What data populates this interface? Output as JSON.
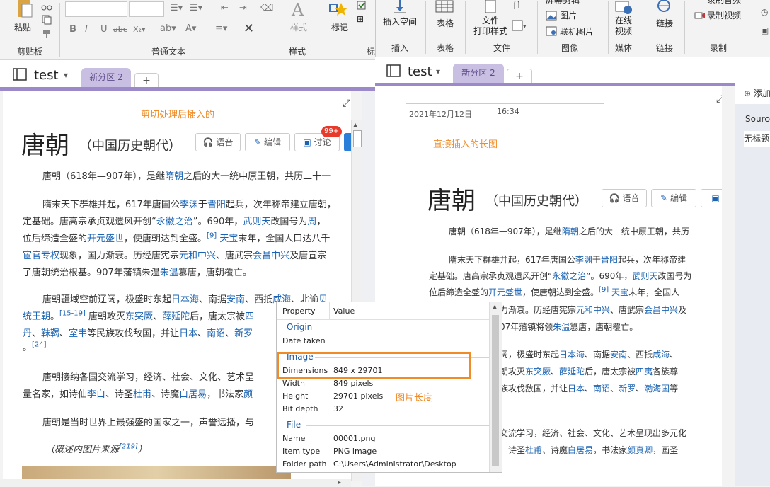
{
  "left_ribbon": {
    "paste": "粘贴",
    "clipboard": "剪贴板",
    "basic_text": "普通文本",
    "styles": "样式",
    "styles_btn": "样式",
    "tags": "标记",
    "tags_short": "标"
  },
  "right_ribbon": {
    "insert_space": "插入空间",
    "insert_group": "插入",
    "table": "表格",
    "table_group": "表格",
    "file_print": "文件\n打印样式",
    "file_group": "文件",
    "picture": "图片",
    "online_picture": "联机图片",
    "image_group": "图像",
    "online_video": "在线\n视频",
    "media_group": "媒体",
    "link": "链接",
    "link_group": "链接",
    "record_video": "录制视频",
    "record_group": "录制",
    "screen_clip": "屏幕剪辑",
    "record_audio": "录制音频"
  },
  "left_window": {
    "notebook": "test",
    "section_tab": "新分区 2",
    "plus": "+",
    "caption": "剪切处理后插入的",
    "title": "唐朝",
    "subtitle": "（中国历史朝代）",
    "btn_voice": "语音",
    "btn_edit": "编辑",
    "btn_discuss": "讨论",
    "badge": "99+",
    "lines": [
      [
        "唐朝（618年—907年），是继",
        "隋朝",
        "之后的大一统中原王朝，共历二十一"
      ],
      [
        "隋末天下群雄并起，617年唐国公",
        "李渊",
        "于",
        "晋阳",
        "起兵，次年称帝建立唐朝，"
      ],
      [
        "定基础。唐高宗承贞观遗风开创“",
        "永徽之治",
        "”。690年，",
        "武则天",
        "改国号为",
        "周",
        "，"
      ],
      [
        "位后缔造全盛的",
        "开元盛世",
        "，使唐朝达到全盛。",
        "[9]",
        " ",
        "天宝",
        "末年，全国人口达八千"
      ],
      [
        "宦官专权",
        "现象，国力渐衰。历经唐宪宗",
        "元和中兴",
        "、唐武宗",
        "会昌中兴",
        "及唐宣宗"
      ],
      [
        "了唐朝统治根基。907年藩镇朱温",
        "朱温",
        "篡唐，唐朝覆亡。"
      ],
      [
        "唐朝疆域空前辽阔，极盛时东起",
        "日本海",
        "、南据",
        "安南",
        "、西抵",
        "咸海",
        "、北逾",
        "贝"
      ],
      [
        "统王朝",
        "。",
        "[15-19]",
        " 唐朝攻灭",
        "东突厥",
        "、",
        "薛延陀",
        "后，唐太宗被",
        "四"
      ],
      [
        "丹",
        "、",
        "靺鞨",
        "、",
        "室韦",
        "等民族攻伐敌国，并让",
        "日本",
        "、",
        "南诏",
        "、",
        "新罗"
      ],
      [
        "[24]"
      ],
      [
        "唐朝接纳各国交流学习，经济、社会、文化、艺术呈"
      ],
      [
        "量名家，如诗仙",
        "李白",
        "、诗圣",
        "杜甫",
        "、诗魔",
        "白居易",
        "，书法家",
        "颜"
      ],
      [
        "唐朝是当时世界上最强盛的国家之一，声誉远播，与"
      ],
      [
        "（概述内图片来源",
        "[219]",
        "）"
      ]
    ]
  },
  "right_window": {
    "notebook": "test",
    "section_tab": "新分区 2",
    "plus": "+",
    "date": "2021年12月12日",
    "time": "16:34",
    "caption": "直接插入的长图",
    "title": "唐朝",
    "subtitle": "（中国历史朝代）",
    "btn_voice": "语音",
    "btn_edit": "编辑",
    "lines": [
      [
        "唐朝（618年—907年），是继",
        "隋朝",
        "之后的大一统中原王朝，共历"
      ],
      [
        "隋末天下群雄并起，617年唐国公",
        "李渊",
        "于",
        "晋阳",
        "起兵，次年称帝建"
      ],
      [
        "定基础。唐高宗承贞观遗风开创“",
        "永徽之治",
        "”。690年，",
        "武则天",
        "改国号为"
      ],
      [
        "位后缔造全盛的",
        "开元盛世",
        "，使唐朝达到全盛。",
        "[9]",
        " ",
        "天宝",
        "末年，全国人"
      ],
      [
        "力渐衰。历经唐宪宗",
        "元和中兴",
        "、唐武宗",
        "会昌中兴",
        "及"
      ],
      [
        "07年藩镇将领",
        "朱温",
        "篡唐，唐朝覆亡。"
      ],
      [
        "阔，极盛时东起",
        "日本海",
        "、南据",
        "安南",
        "、西抵",
        "咸海",
        "、"
      ],
      [
        "朝攻灭",
        "东突厥",
        "、",
        "薛延陀",
        "后，唐太宗被",
        "四夷",
        "各族尊"
      ],
      [
        "族攻伐敌国，并让",
        "日本",
        "、",
        "南诏",
        "、",
        "新罗",
        "、",
        "渤海国",
        "等"
      ],
      [
        "交流学习，经济、社会、文化、艺术呈现出多元化"
      ],
      [
        "、诗圣",
        "杜甫",
        "、诗魔",
        "白居易",
        "，书法家",
        "颜真卿",
        "，画圣"
      ]
    ],
    "side_add": "添加",
    "side_source": "Source",
    "side_untitled": "无标题"
  },
  "properties": {
    "col_property": "Property",
    "col_value": "Value",
    "origin": "Origin",
    "date_taken": "Date taken",
    "image": "Image",
    "dimensions_label": "Dimensions",
    "dimensions_value": "849 x 29701",
    "width_label": "Width",
    "width_value": "849 pixels",
    "height_label": "Height",
    "height_value": "29701 pixels",
    "depth_label": "Bit depth",
    "depth_value": "32",
    "file": "File",
    "name_label": "Name",
    "name_value": "00001.png",
    "type_label": "Item type",
    "type_value": "PNG image",
    "folder_label": "Folder path",
    "folder_value": "C:\\Users\\Administrator\\Desktop",
    "annotation": "图片长度"
  },
  "colors": {
    "accent_purple": "#9b89c9",
    "link_blue": "#1a63b3",
    "annotation_orange": "#f08c28",
    "badge_red": "#e83a2a"
  }
}
